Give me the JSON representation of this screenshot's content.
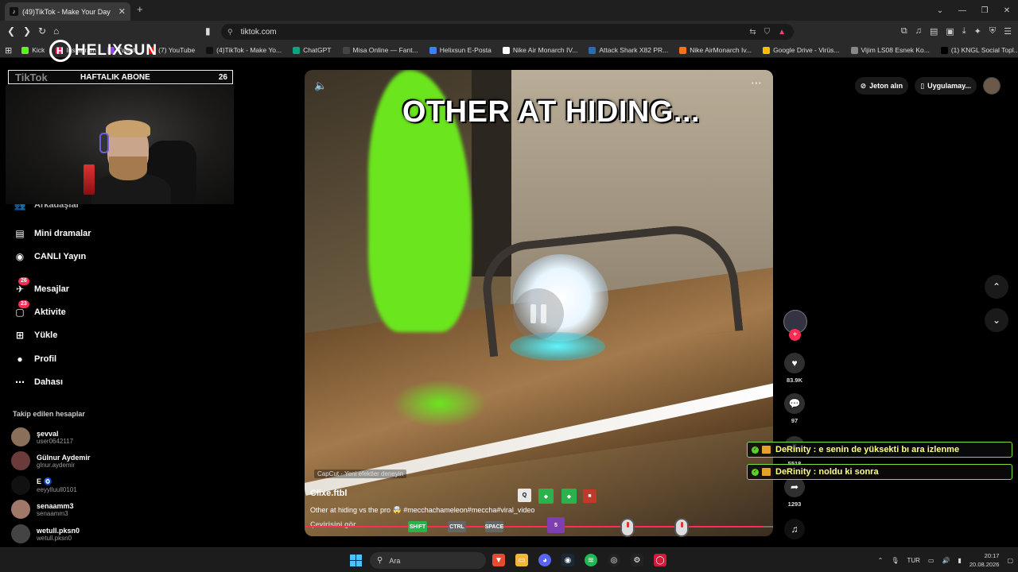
{
  "browser": {
    "tab_title": "(49)TikTok - Make Your Day",
    "new_tab": "+",
    "url": "tiktok.com",
    "bookmarks": [
      {
        "label": "Kick",
        "color": "#53fc18"
      },
      {
        "label": "Instagram",
        "color": "#e1306c"
      },
      {
        "label": "Twitch",
        "color": "#9146ff"
      },
      {
        "label": "(7) YouTube",
        "color": "#ff0000"
      },
      {
        "label": "(4)TikTok - Make Yo...",
        "color": "#111111"
      },
      {
        "label": "ChatGPT",
        "color": "#10a37f"
      },
      {
        "label": "Misa Online — Fant...",
        "color": "#444444"
      },
      {
        "label": "Helixsun E-Posta",
        "color": "#3b82f6"
      },
      {
        "label": "Nike Air Monarch IV...",
        "color": "#ffffff"
      },
      {
        "label": "Attack Shark X82 PR...",
        "color": "#2b6cb0"
      },
      {
        "label": "Nike AirMonarch Iv...",
        "color": "#f97316"
      },
      {
        "label": "Google Drive - Virüs...",
        "color": "#fbbc04"
      },
      {
        "label": "Vijim LS08 Esnek Ko...",
        "color": "#888888"
      },
      {
        "label": "(1) KNGL Social Topl...",
        "color": "#000000"
      }
    ]
  },
  "overlay": {
    "logo": "HELIXSUN",
    "subs_label": "HAFTALIK ABONE",
    "subs_brand": "TikTok",
    "subs_count": "26"
  },
  "sidebar": {
    "partial_item": "Arkadaşlar",
    "items": [
      {
        "label": "Mini dramalar",
        "icon": "film-icon"
      },
      {
        "label": "CANLI Yayın",
        "icon": "live-icon"
      },
      {
        "label": "Mesajlar",
        "icon": "messages-icon",
        "badge": "26"
      },
      {
        "label": "Aktivite",
        "icon": "activity-icon",
        "badge": "23"
      },
      {
        "label": "Yükle",
        "icon": "upload-icon"
      },
      {
        "label": "Profil",
        "icon": "profile-icon"
      },
      {
        "label": "Dahası",
        "icon": "more-icon"
      }
    ],
    "following_header": "Takip edilen hesaplar",
    "following": [
      {
        "name": "şevval",
        "user": "user0642117"
      },
      {
        "name": "Gülnur Aydemir",
        "user": "glnur.aydemir"
      },
      {
        "name": "E 🧿",
        "user": "eeyylluull0101"
      },
      {
        "name": "senaamm3",
        "user": "senaamm3"
      },
      {
        "name": "wetull.pksn0",
        "user": "wetull.pksn0"
      }
    ]
  },
  "video": {
    "caption": "OTHER AT HIDING...",
    "capcut": "CapCut · Yeni efektler deneyin",
    "username": "Clixe.ftbl",
    "description": "Other at hiding vs the pro 🤯 #mecchachameleon#meccha#viral_video",
    "translate": "Çevirisini gör",
    "progress": 0.98
  },
  "keys": [
    {
      "label": "Q",
      "color": "#e8e8e8",
      "text": "#000"
    },
    {
      "label": "◆",
      "color": "#2bb24c",
      "text": "#fff"
    },
    {
      "label": "◆",
      "color": "#2bb24c",
      "text": "#fff"
    },
    {
      "label": "■",
      "color": "#c0392b",
      "text": "#fff"
    },
    {
      "label": "SHIFT",
      "color": "#2bb24c",
      "text": "#fff"
    },
    {
      "label": "CTRL",
      "color": "#666666",
      "text": "#fff"
    },
    {
      "label": "SPACE",
      "color": "#666666",
      "text": "#fff"
    },
    {
      "label": "5",
      "color": "#7e3fb0",
      "text": "#fff"
    }
  ],
  "actions": {
    "likes": "83.9K",
    "comments": "97",
    "saves": "5518",
    "shares": "1293"
  },
  "topright": {
    "coins": "Jeton alın",
    "app": "Uygulamay..."
  },
  "chat": [
    {
      "text": "DeRinity : e senin de yüksekti bı ara izlenme"
    },
    {
      "text": "DeRinity : noldu ki sonra"
    }
  ],
  "taskbar": {
    "search": "Ara",
    "lang": "TUR",
    "time": "20:17",
    "date": "20.08.2026"
  }
}
